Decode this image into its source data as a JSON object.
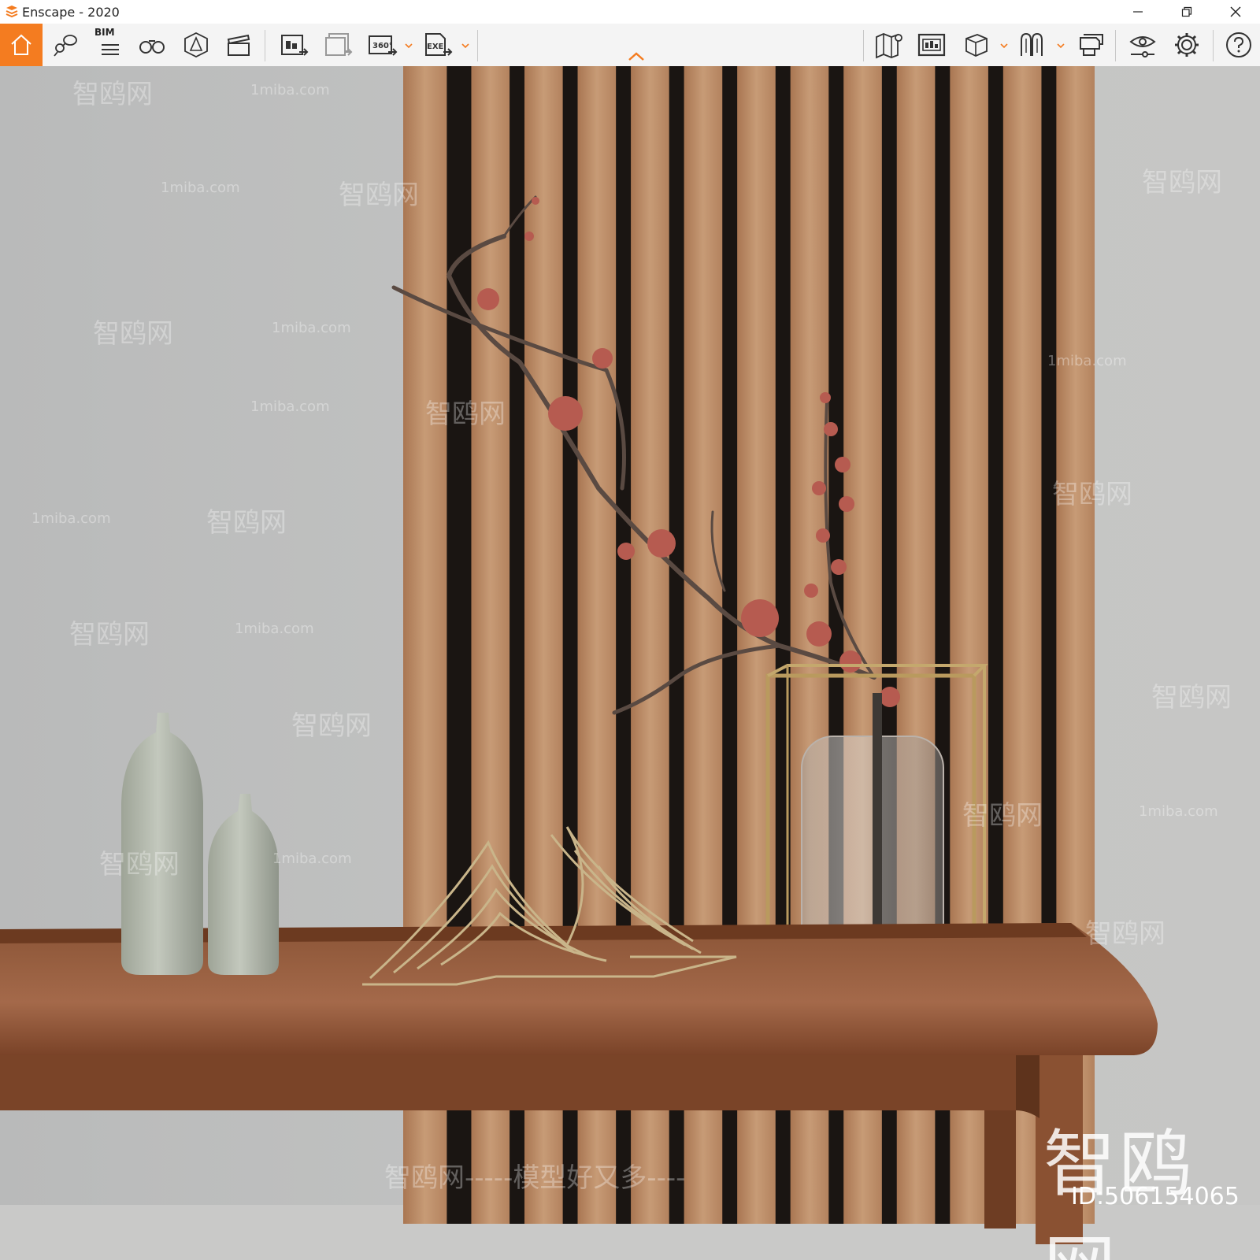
{
  "window": {
    "title": "Enscape - 2020"
  },
  "toolbar": {
    "bim_label": "BIM",
    "buttons": [
      "home-icon",
      "map-pin-icon",
      "bim-list-icon",
      "binoculars-icon",
      "clipping-icon",
      "video-clapper-icon",
      "export-image-icon",
      "batch-export-icon",
      "export-360-icon",
      "export-exe-icon",
      "map-icon",
      "asset-library-icon",
      "cube-view-icon",
      "material-icon",
      "vr-headset-icon",
      "visual-settings-icon",
      "settings-icon",
      "help-icon"
    ],
    "export_360_label": "360°",
    "export_exe_label": "EXE",
    "accent": "#f47c20"
  },
  "watermarks": {
    "site": "1miba.com",
    "brand": "智鸥网",
    "slogan": "智鸥网-----模型好又多----",
    "brand_large": "智鸥网",
    "id": "ID:506154065"
  }
}
